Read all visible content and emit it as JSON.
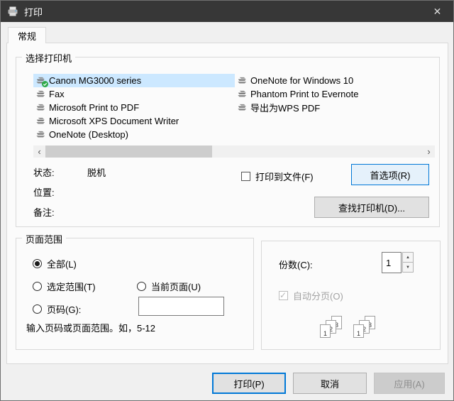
{
  "window": {
    "title": "打印",
    "close_glyph": "✕"
  },
  "tab": {
    "label": "常规"
  },
  "printer_group": {
    "title": "选择打印机",
    "columns": {
      "left": [
        "Canon MG3000 series",
        "Fax",
        "Microsoft Print to PDF",
        "Microsoft XPS Document Writer",
        "OneNote (Desktop)"
      ],
      "right": [
        "OneNote for Windows 10",
        "Phantom Print to Evernote",
        "导出为WPS PDF"
      ]
    },
    "selected_printer": "Canon MG3000 series",
    "default_printer": "Canon MG3000 series",
    "scrollbar": {
      "left_arrow": "‹",
      "right_arrow": "›"
    }
  },
  "status": {
    "labels": {
      "status": "状态:",
      "location": "位置:",
      "comment": "备注:"
    },
    "values": {
      "status": "脱机",
      "location": "",
      "comment": ""
    }
  },
  "options": {
    "print_to_file": "打印到文件(F)",
    "preferences": "首选项(R)",
    "find_printer": "查找打印机(D)..."
  },
  "page_range": {
    "title": "页面范围",
    "all": "全部(L)",
    "selection": "选定范围(T)",
    "current_page": "当前页面(U)",
    "pages": "页码(G):",
    "pages_value": "",
    "hint": "输入页码或页面范围。如，5-12"
  },
  "copies": {
    "label": "份数(C):",
    "count": "1",
    "up_glyph": "▲",
    "down_glyph": "▼",
    "collate": "自动分页(O)",
    "collate_pages": [
      "1",
      "2",
      "3"
    ]
  },
  "actions": {
    "print": "打印(P)",
    "cancel": "取消",
    "apply": "应用(A)"
  },
  "colors": {
    "accent": "#0078d7",
    "selection_bg": "#cce8ff",
    "titlebar_bg": "#373737"
  }
}
